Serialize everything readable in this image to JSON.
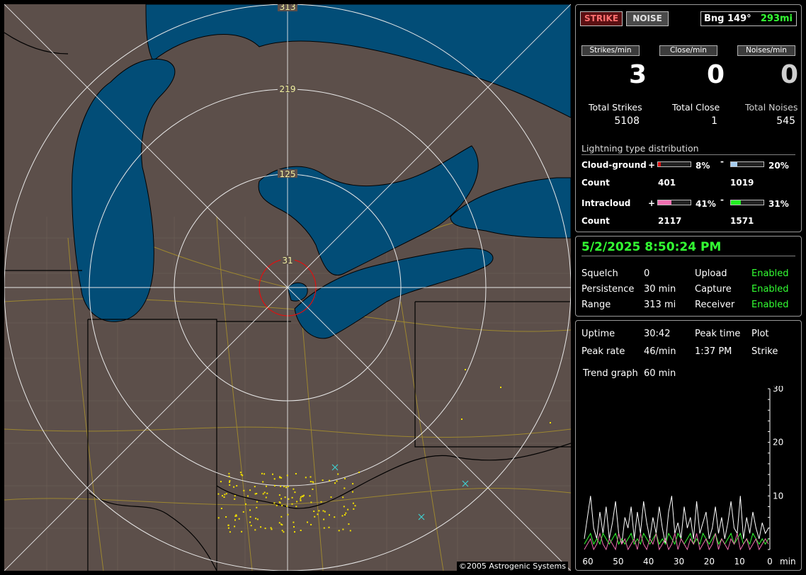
{
  "map": {
    "ring_labels": [
      "313",
      "219",
      "125",
      "31"
    ],
    "copyright": "©2005 Astrogenic Systems"
  },
  "top": {
    "strike_button": "STRIKE",
    "noise_button": "NOISE",
    "bearing": "Bng 149°",
    "distance": "293mi"
  },
  "rates": {
    "strikes_label": "Strikes/min",
    "close_label": "Close/min",
    "noises_label": "Noises/min",
    "strikes_value": "3",
    "close_value": "0",
    "noises_value": "0"
  },
  "totals": {
    "strikes_label": "Total Strikes",
    "close_label": "Total Close",
    "noises_label": "Total Noises",
    "strikes_value": "5108",
    "close_value": "1",
    "noises_value": "545"
  },
  "distribution": {
    "title": "Lightning type distribution",
    "cg_label": "Cloud-ground",
    "ic_label": "Intracloud",
    "count_label": "Count",
    "plus": "+",
    "minus": "-",
    "cg_pos_pct": "8%",
    "cg_neg_pct": "20%",
    "ic_pos_pct": "41%",
    "ic_neg_pct": "31%",
    "cg_pos_fill": 0.08,
    "cg_neg_fill": 0.2,
    "ic_pos_fill": 0.41,
    "ic_neg_fill": 0.31,
    "cg_pos_count": "401",
    "cg_neg_count": "1019",
    "ic_pos_count": "2117",
    "ic_neg_count": "1571",
    "colors": {
      "cg_pos": "#e01010",
      "cg_neg": "#a8cef0",
      "ic_pos": "#ee6fb0",
      "ic_neg": "#22ee22"
    }
  },
  "status": {
    "datetime": "5/2/2025 8:50:24 PM",
    "squelch_label": "Squelch",
    "squelch_value": "0",
    "persistence_label": "Persistence",
    "persistence_value": "30 min",
    "range_label": "Range",
    "range_value": "313 mi",
    "upload_label": "Upload",
    "upload_value": "Enabled",
    "capture_label": "Capture",
    "capture_value": "Enabled",
    "receiver_label": "Receiver",
    "receiver_value": "Enabled"
  },
  "stats": {
    "uptime_label": "Uptime",
    "uptime_value": "30:42",
    "peak_rate_label": "Peak rate",
    "peak_rate_value": "46/min",
    "peak_time_label": "Peak time",
    "peak_time_value": "1:37 PM",
    "plot_label": "Plot",
    "plot_value": "Strike",
    "trend_label": "Trend graph",
    "trend_value": "60 min"
  },
  "chart_data": {
    "type": "line",
    "x_ticks": [
      "60",
      "50",
      "40",
      "30",
      "20",
      "10",
      "0"
    ],
    "x_unit": "min",
    "y_ticks": [
      "30",
      "20",
      "10"
    ],
    "ylim": [
      0,
      30
    ],
    "series": [
      {
        "color": "#ffffff",
        "values": [
          2,
          6,
          10,
          4,
          2,
          7,
          3,
          8,
          2,
          5,
          9,
          3,
          1,
          6,
          4,
          8,
          2,
          7,
          3,
          9,
          5,
          2,
          6,
          3,
          8,
          4,
          1,
          7,
          10,
          3,
          5,
          2,
          8,
          4,
          6,
          2,
          9,
          3,
          5,
          7,
          2,
          4,
          8,
          3,
          6,
          2,
          5,
          9,
          4,
          3,
          10,
          2,
          6,
          3,
          7,
          4,
          2,
          5,
          3,
          4
        ]
      },
      {
        "color": "#33ff33",
        "values": [
          1,
          2,
          3,
          1,
          2,
          1,
          3,
          2,
          1,
          2,
          3,
          1,
          2,
          1,
          2,
          3,
          1,
          2,
          1,
          3,
          2,
          1,
          2,
          3,
          1,
          2,
          1,
          3,
          2,
          1,
          3,
          2,
          1,
          2,
          3,
          1,
          2,
          1,
          3,
          2,
          1,
          2,
          3,
          1,
          2,
          1,
          2,
          3,
          1,
          2,
          3,
          1,
          2,
          1,
          3,
          2,
          1,
          2,
          1,
          2
        ]
      },
      {
        "color": "#ee6fb0",
        "values": [
          0,
          1,
          2,
          0,
          1,
          3,
          1,
          0,
          2,
          1,
          0,
          3,
          1,
          2,
          0,
          1,
          2,
          0,
          3,
          1,
          0,
          2,
          1,
          3,
          0,
          1,
          2,
          0,
          1,
          3,
          0,
          2,
          1,
          0,
          2,
          1,
          3,
          0,
          1,
          2,
          0,
          1,
          3,
          0,
          2,
          1,
          0,
          2,
          1,
          3,
          0,
          1,
          2,
          0,
          1,
          2,
          0,
          1,
          2,
          1
        ]
      }
    ]
  }
}
